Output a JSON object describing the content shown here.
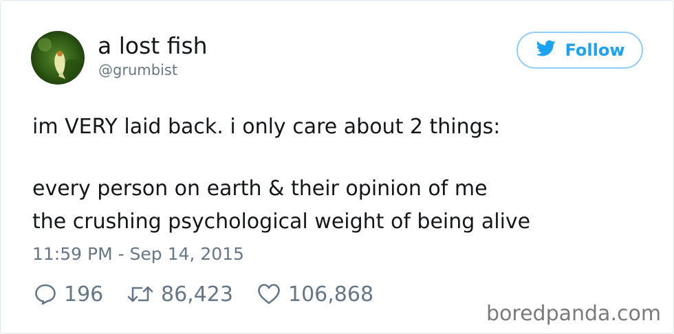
{
  "tweet": {
    "author_name": "a lost fish",
    "author_handle": "@grumbist",
    "follow_label": "Follow",
    "text_lines": [
      "im VERY laid back. i only care about 2 things:",
      "every person on earth & their opinion of me",
      "the crushing psychological weight of being alive"
    ],
    "timestamp": "11:59 PM - Sep 14, 2015",
    "replies": "196",
    "retweets": "86,423",
    "likes": "106,868"
  },
  "watermark": "boredpanda.com",
  "colors": {
    "twitter_blue": "#1da1f2",
    "secondary_text": "#657786",
    "primary_text": "#14171a"
  },
  "icons": [
    "twitter-bird-icon",
    "reply-icon",
    "retweet-icon",
    "heart-icon"
  ]
}
